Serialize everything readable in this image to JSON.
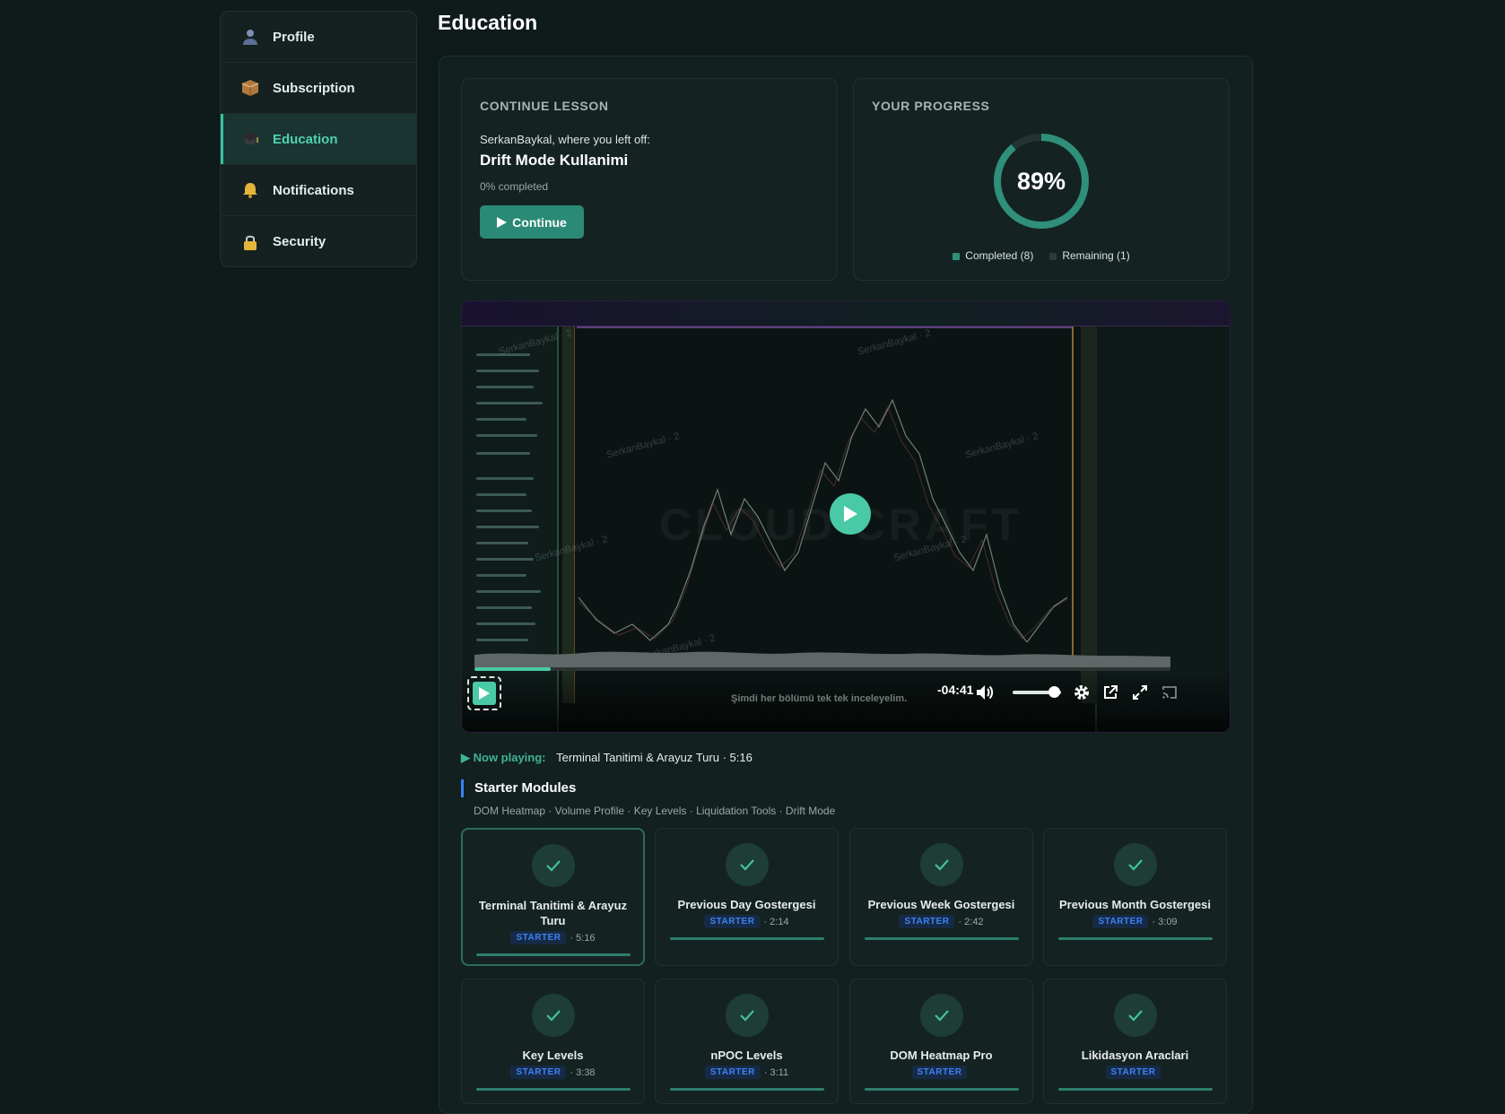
{
  "sidebar": {
    "items": [
      {
        "label": "Profile",
        "icon": "user-icon"
      },
      {
        "label": "Subscription",
        "icon": "package-icon"
      },
      {
        "label": "Education",
        "icon": "graduation-cap-icon",
        "active": true
      },
      {
        "label": "Notifications",
        "icon": "bell-icon"
      },
      {
        "label": "Security",
        "icon": "lock-icon"
      }
    ]
  },
  "header": {
    "title": "Education"
  },
  "continue_lesson": {
    "heading": "CONTINUE LESSON",
    "lead": "SerkanBaykal, where you left off:",
    "lesson_title": "Drift Mode Kullanimi",
    "completed_text": "0% completed",
    "button_label": "Continue"
  },
  "progress": {
    "heading": "YOUR PROGRESS",
    "percent_label": "89%",
    "percent_value": 89,
    "completed_label": "Completed (8)",
    "remaining_label": "Remaining (1)",
    "completed_color": "#2f8f7a",
    "remaining_color": "#2a3533"
  },
  "video": {
    "watermark_text": "SerkanBaykal · 2",
    "logo_text": "CLOUD CRAFT",
    "subtitle": "Şimdi her bölümü tek tek inceleyelim.",
    "time_remaining": "-04:41",
    "playback_progress": 0.11,
    "volume_level": 0.85,
    "accent_color": "#49c9a6"
  },
  "now_playing": {
    "label": "▶ Now playing:",
    "value": "Terminal Tanitimi & Arayuz Turu · 5:16"
  },
  "section": {
    "title": "Starter Modules",
    "subtitle": "DOM Heatmap · Volume Profile · Key Levels · Liquidation Tools · Drift Mode"
  },
  "modules": [
    {
      "title": "Terminal Tanitimi & Arayuz Turu",
      "badge": "STARTER",
      "duration": "· 5:16",
      "active": true
    },
    {
      "title": "Previous Day Gostergesi",
      "badge": "STARTER",
      "duration": "· 2:14"
    },
    {
      "title": "Previous Week Gostergesi",
      "badge": "STARTER",
      "duration": "· 2:42"
    },
    {
      "title": "Previous Month Gostergesi",
      "badge": "STARTER",
      "duration": "· 3:09"
    },
    {
      "title": "Key Levels",
      "badge": "STARTER",
      "duration": "· 3:38"
    },
    {
      "title": "nPOC Levels",
      "badge": "STARTER",
      "duration": "· 3:11"
    },
    {
      "title": "DOM Heatmap Pro",
      "badge": "STARTER",
      "duration": ""
    },
    {
      "title": "Likidasyon Araclari",
      "badge": "STARTER",
      "duration": ""
    }
  ]
}
